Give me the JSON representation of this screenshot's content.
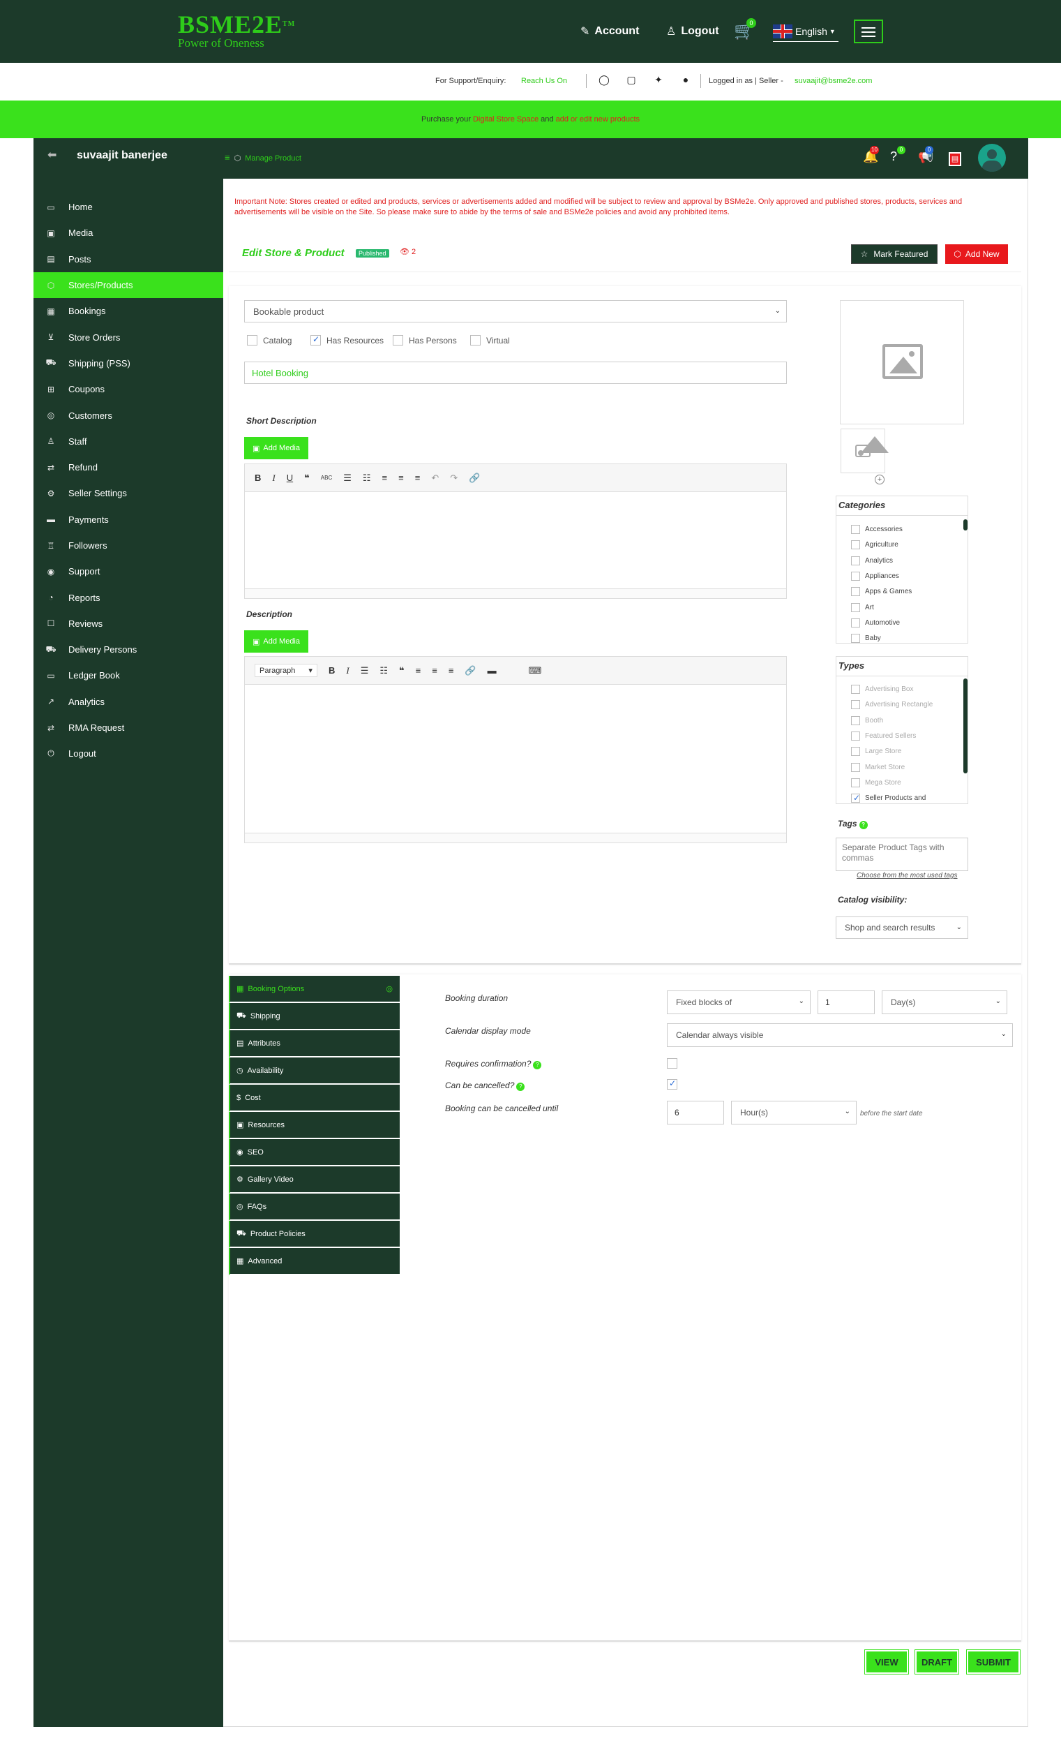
{
  "brand": {
    "name": "BSME2E",
    "tm": "TM",
    "tagline": "Power of Oneness"
  },
  "topnav": {
    "account": "Account",
    "logout": "Logout",
    "cart_count": "0",
    "language": "English"
  },
  "support": {
    "label": "For Support/Enquiry:",
    "reach": "Reach Us On",
    "logged_in": "Logged in as | Seller -",
    "email": "suvaajit@bsme2e.com"
  },
  "banner": {
    "pre": "Purchase your",
    "link1": "Digital Store Space",
    "mid": "and",
    "link2": "add or edit new products"
  },
  "header": {
    "user": "suvaajit banerjee",
    "breadcrumb": "Manage Product",
    "badges": {
      "notifications": "10",
      "enquiry": "0",
      "announcements": "0"
    }
  },
  "sidebar": {
    "items": [
      {
        "label": "Home",
        "icon": "▭"
      },
      {
        "label": "Media",
        "icon": "▣"
      },
      {
        "label": "Posts",
        "icon": "▤"
      },
      {
        "label": "Stores/Products",
        "icon": "⬡"
      },
      {
        "label": "Bookings",
        "icon": "▦"
      },
      {
        "label": "Store Orders",
        "icon": "⊻"
      },
      {
        "label": "Shipping (PSS)",
        "icon": "⛟"
      },
      {
        "label": "Coupons",
        "icon": "⊞"
      },
      {
        "label": "Customers",
        "icon": "◎"
      },
      {
        "label": "Staff",
        "icon": "♙"
      },
      {
        "label": "Refund",
        "icon": "⇄"
      },
      {
        "label": "Seller Settings",
        "icon": "⚙"
      },
      {
        "label": "Payments",
        "icon": "▬"
      },
      {
        "label": "Followers",
        "icon": "♖"
      },
      {
        "label": "Support",
        "icon": "◉"
      },
      {
        "label": "Reports",
        "icon": "◔"
      },
      {
        "label": "Reviews",
        "icon": "☐"
      },
      {
        "label": "Delivery Persons",
        "icon": "⛟"
      },
      {
        "label": "Ledger Book",
        "icon": "▭"
      },
      {
        "label": "Analytics",
        "icon": "↗"
      },
      {
        "label": "RMA Request",
        "icon": "⇄"
      },
      {
        "label": "Logout",
        "icon": "⏻"
      }
    ],
    "active_index": 3
  },
  "notice": "Important Note: Stores created or edited and products, services or advertisements added and modified will be subject to review and approval by BSMe2e. Only approved and published stores, products, services and advertisements will be visible on the Site. So please make sure to abide by the terms of sale and BSMe2e policies and avoid any prohibited items.",
  "edit": {
    "title": "Edit Store & Product",
    "status": "Published",
    "views": "2",
    "mark_featured": "Mark Featured",
    "add_new": "Add New"
  },
  "product": {
    "type": "Bookable product",
    "options": [
      {
        "label": "Catalog",
        "checked": false
      },
      {
        "label": "Has Resources",
        "checked": true
      },
      {
        "label": "Has Persons",
        "checked": false
      },
      {
        "label": "Virtual",
        "checked": false
      }
    ],
    "title": "Hotel Booking",
    "short_description_label": "Short Description",
    "description_label": "Description",
    "add_media": "Add Media",
    "paragraph": "Paragraph"
  },
  "categories": {
    "title": "Categories",
    "items": [
      "Accessories",
      "Agriculture",
      "Analytics",
      "Appliances",
      "Apps & Games",
      "Art",
      "Automotive",
      "Baby"
    ]
  },
  "types": {
    "title": "Types",
    "items": [
      {
        "label": "Advertising Box",
        "checked": false
      },
      {
        "label": "Advertising Rectangle",
        "checked": false
      },
      {
        "label": "Booth",
        "checked": false
      },
      {
        "label": "Featured Sellers",
        "checked": false
      },
      {
        "label": "Large Store",
        "checked": false
      },
      {
        "label": "Market Store",
        "checked": false
      },
      {
        "label": "Mega Store",
        "checked": false
      },
      {
        "label": "Seller Products and",
        "checked": true
      }
    ]
  },
  "tags": {
    "title": "Tags",
    "placeholder": "Separate Product Tags with commas",
    "link": "Choose from the most used tags"
  },
  "catalog": {
    "title": "Catalog visibility:",
    "value": "Shop and search results"
  },
  "tabs": [
    {
      "label": "Booking Options",
      "icon": "▦"
    },
    {
      "label": "Shipping",
      "icon": "⛟"
    },
    {
      "label": "Attributes",
      "icon": "▤"
    },
    {
      "label": "Availability",
      "icon": "◷"
    },
    {
      "label": "Cost",
      "icon": "$"
    },
    {
      "label": "Resources",
      "icon": "▣"
    },
    {
      "label": "SEO",
      "icon": "◉"
    },
    {
      "label": "Gallery Video",
      "icon": "⚙"
    },
    {
      "label": "FAQs",
      "icon": "◎"
    },
    {
      "label": "Product Policies",
      "icon": "⛟"
    },
    {
      "label": "Advanced",
      "icon": "▦"
    }
  ],
  "booking": {
    "duration_label": "Booking duration",
    "duration_type": "Fixed blocks of",
    "duration_value": "1",
    "duration_unit": "Day(s)",
    "calendar_label": "Calendar display mode",
    "calendar_value": "Calendar always visible",
    "confirmation_label": "Requires confirmation?",
    "cancel_label": "Can be cancelled?",
    "cancel_until_label": "Booking can be cancelled until",
    "cancel_until_value": "6",
    "cancel_until_unit": "Hour(s)",
    "before_text": "before the start date"
  },
  "actions": {
    "view": "VIEW",
    "draft": "DRAFT",
    "submit": "SUBMIT"
  },
  "colors": {
    "dark": "#1c3a2a",
    "green": "#3ae11c",
    "red": "#e8181c"
  }
}
